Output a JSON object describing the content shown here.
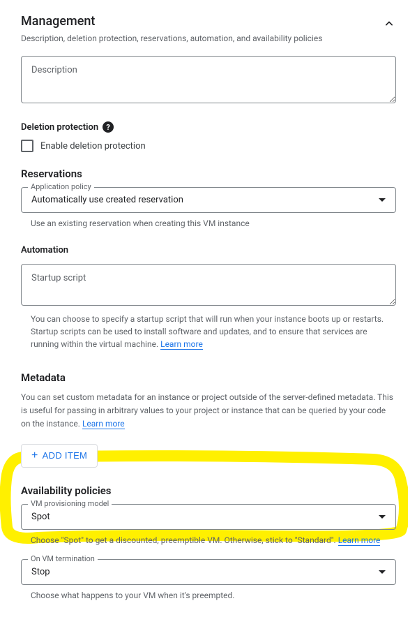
{
  "header": {
    "title": "Management",
    "subtitle": "Description, deletion protection, reservations, automation, and availability policies"
  },
  "description": {
    "placeholder": "Description"
  },
  "deletion": {
    "title": "Deletion protection",
    "checkbox_label": "Enable deletion protection"
  },
  "reservations": {
    "title": "Reservations",
    "policy_label": "Application policy",
    "policy_value": "Automatically use created reservation",
    "helper": "Use an existing reservation when creating this VM instance"
  },
  "automation": {
    "title": "Automation",
    "placeholder": "Startup script",
    "helper_1": "You can choose to specify a startup script that will run when your instance boots up or restarts. Startup scripts can be used to install software and updates, and to ensure that services are running within the virtual machine. ",
    "learn_more": "Learn more"
  },
  "metadata": {
    "title": "Metadata",
    "description": "You can set custom metadata for an instance or project outside of the server-defined metadata. This is useful for passing in arbitrary values to your project or instance that can be queried by your code on the instance. ",
    "learn_more": "Learn more",
    "add_item": "ADD ITEM"
  },
  "availability": {
    "title": "Availability policies",
    "provisioning_label": "VM provisioning model",
    "provisioning_value": "Spot",
    "provisioning_helper_1": "Choose \"Spot\" to get a discounted, preemptible VM. Otherwise, stick to \"Standard\". ",
    "provisioning_learn_more": "Learn more",
    "termination_label": "On VM termination",
    "termination_value": "Stop",
    "termination_helper": "Choose what happens to your VM when it's preempted."
  }
}
